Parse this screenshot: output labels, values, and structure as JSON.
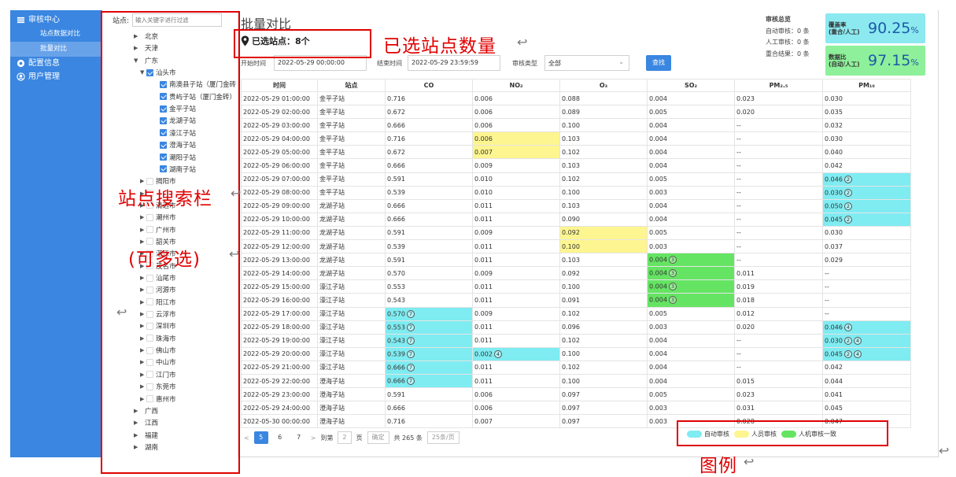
{
  "nav": {
    "items": [
      {
        "label": "审核中心",
        "icon": "audit-icon"
      },
      {
        "label": "站点数据对比",
        "sub": true
      },
      {
        "label": "批量对比",
        "sub": true,
        "active": true
      },
      {
        "label": "配置信息",
        "icon": "config-icon"
      },
      {
        "label": "用户管理",
        "icon": "user-icon"
      }
    ]
  },
  "tree": {
    "label": "站点:",
    "placeholder": "输入关键字进行过滤",
    "nodes": [
      {
        "label": "北京",
        "level": 1,
        "arrow": "▶",
        "cb": "none"
      },
      {
        "label": "天津",
        "level": 1,
        "arrow": "▶",
        "cb": "none"
      },
      {
        "label": "广东",
        "level": 1,
        "arrow": "▼",
        "cb": "none"
      },
      {
        "label": "汕头市",
        "level": 2,
        "arrow": "▼",
        "cb": "on"
      },
      {
        "label": "南澳县子站（厦门金砖",
        "level": 3,
        "arrow": "",
        "cb": "on"
      },
      {
        "label": "贵屿子站（厦门金砖）",
        "level": 3,
        "arrow": "",
        "cb": "on"
      },
      {
        "label": "金平子站",
        "level": 3,
        "arrow": "",
        "cb": "on"
      },
      {
        "label": "龙湖子站",
        "level": 3,
        "arrow": "",
        "cb": "on"
      },
      {
        "label": "濠江子站",
        "level": 3,
        "arrow": "",
        "cb": "on"
      },
      {
        "label": "澄海子站",
        "level": 3,
        "arrow": "",
        "cb": "on"
      },
      {
        "label": "潮阳子站",
        "level": 3,
        "arrow": "",
        "cb": "on"
      },
      {
        "label": "湖南子站",
        "level": 3,
        "arrow": "",
        "cb": "on"
      },
      {
        "label": "揭阳市",
        "level": 2,
        "arrow": "▶",
        "cb": "off"
      },
      {
        "label": "",
        "level": 2,
        "arrow": "▶",
        "cb": "off"
      },
      {
        "label": "清远市",
        "level": 2,
        "arrow": "▶",
        "cb": "off"
      },
      {
        "label": "潮州市",
        "level": 2,
        "arrow": "▶",
        "cb": "off"
      },
      {
        "label": "广州市",
        "level": 2,
        "arrow": "▶",
        "cb": "off"
      },
      {
        "label": "韶关市",
        "level": 2,
        "arrow": "▶",
        "cb": "off"
      },
      {
        "label": "湛江市",
        "level": 2,
        "arrow": "▶",
        "cb": "off"
      },
      {
        "label": "茂名市",
        "level": 2,
        "arrow": "▶",
        "cb": "off"
      },
      {
        "label": "汕尾市",
        "level": 2,
        "arrow": "▶",
        "cb": "off"
      },
      {
        "label": "河源市",
        "level": 2,
        "arrow": "▶",
        "cb": "off"
      },
      {
        "label": "阳江市",
        "level": 2,
        "arrow": "▶",
        "cb": "off"
      },
      {
        "label": "云浮市",
        "level": 2,
        "arrow": "▶",
        "cb": "off"
      },
      {
        "label": "深圳市",
        "level": 2,
        "arrow": "▶",
        "cb": "off"
      },
      {
        "label": "珠海市",
        "level": 2,
        "arrow": "▶",
        "cb": "off"
      },
      {
        "label": "佛山市",
        "level": 2,
        "arrow": "▶",
        "cb": "off"
      },
      {
        "label": "中山市",
        "level": 2,
        "arrow": "▶",
        "cb": "off"
      },
      {
        "label": "江门市",
        "level": 2,
        "arrow": "▶",
        "cb": "off"
      },
      {
        "label": "东莞市",
        "level": 2,
        "arrow": "▶",
        "cb": "off"
      },
      {
        "label": "惠州市",
        "level": 2,
        "arrow": "▶",
        "cb": "off"
      },
      {
        "label": "广西",
        "level": 1,
        "arrow": "▶",
        "cb": "none"
      },
      {
        "label": "江西",
        "level": 1,
        "arrow": "▶",
        "cb": "none"
      },
      {
        "label": "福建",
        "level": 1,
        "arrow": "▶",
        "cb": "none"
      },
      {
        "label": "湖南",
        "level": 1,
        "arrow": "▶",
        "cb": "none"
      }
    ]
  },
  "page": {
    "title": "批量对比",
    "selected_label": "已选站点：8个"
  },
  "filters": {
    "start_label": "开始时间",
    "start_value": "2022-05-29 00:00:00",
    "end_label": "结束时间",
    "end_value": "2022-05-29 23:59:59",
    "type_label": "审核类型",
    "type_value": "全部",
    "search_button": "查找"
  },
  "stats": {
    "title": "审核总览",
    "auto": "自动审核：0 条",
    "manual": "人工审核：0 条",
    "overlap": "重合结果：0 条"
  },
  "cards": [
    {
      "label1": "覆盖率",
      "label2": "(重合/人工)",
      "value": "90.25",
      "unit": "%",
      "bg": "#8be9ef"
    },
    {
      "label1": "数据比",
      "label2": "(自动/人工)",
      "value": "97.15",
      "unit": "%",
      "bg": "#8ef09a"
    }
  ],
  "table": {
    "headers": [
      "时间",
      "站点",
      "CO",
      "NO₂",
      "O₃",
      "SO₂",
      "PM₂.₅",
      "PM₁₀"
    ],
    "rows": [
      [
        "2022-05-29 01:00:00",
        "金平子站",
        "0.716",
        "0.006",
        "0.088",
        "0.004",
        "0.023",
        "0.030"
      ],
      [
        "2022-05-29 02:00:00",
        "金平子站",
        "0.672",
        "0.006",
        "0.089",
        "0.005",
        "0.020",
        "0.035"
      ],
      [
        "2022-05-29 03:00:00",
        "金平子站",
        "0.666",
        "0.006",
        "0.100",
        "0.004",
        "--",
        "0.032"
      ],
      [
        "2022-05-29 04:00:00",
        "金平子站",
        "0.716",
        "0.006",
        "0.103",
        "0.004",
        "--",
        "0.030"
      ],
      [
        "2022-05-29 05:00:00",
        "金平子站",
        "0.672",
        "0.007",
        "0.102",
        "0.004",
        "--",
        "0.040"
      ],
      [
        "2022-05-29 06:00:00",
        "金平子站",
        "0.666",
        "0.009",
        "0.103",
        "0.004",
        "--",
        "0.042"
      ],
      [
        "2022-05-29 07:00:00",
        "金平子站",
        "0.591",
        "0.010",
        "0.102",
        "0.005",
        "--",
        "0.046"
      ],
      [
        "2022-05-29 08:00:00",
        "金平子站",
        "0.539",
        "0.010",
        "0.100",
        "0.003",
        "--",
        "0.030"
      ],
      [
        "2022-05-29 09:00:00",
        "龙湖子站",
        "0.666",
        "0.011",
        "0.103",
        "0.004",
        "--",
        "0.050"
      ],
      [
        "2022-05-29 10:00:00",
        "龙湖子站",
        "0.666",
        "0.011",
        "0.090",
        "0.004",
        "--",
        "0.045"
      ],
      [
        "2022-05-29 11:00:00",
        "龙湖子站",
        "0.591",
        "0.009",
        "0.092",
        "0.005",
        "--",
        "0.030"
      ],
      [
        "2022-05-29 12:00:00",
        "龙湖子站",
        "0.539",
        "0.011",
        "0.100",
        "0.003",
        "--",
        "0.037"
      ],
      [
        "2022-05-29 13:00:00",
        "龙湖子站",
        "0.591",
        "0.011",
        "0.103",
        "0.004",
        "--",
        "0.029"
      ],
      [
        "2022-05-29 14:00:00",
        "龙湖子站",
        "0.570",
        "0.009",
        "0.092",
        "0.004",
        "0.011",
        "--"
      ],
      [
        "2022-05-29 15:00:00",
        "濠江子站",
        "0.553",
        "0.011",
        "0.100",
        "0.004",
        "0.019",
        "--"
      ],
      [
        "2022-05-29 16:00:00",
        "濠江子站",
        "0.543",
        "0.011",
        "0.091",
        "0.004",
        "0.018",
        "--"
      ],
      [
        "2022-05-29 17:00:00",
        "濠江子站",
        "0.570",
        "0.009",
        "0.102",
        "0.005",
        "0.012",
        "--"
      ],
      [
        "2022-05-29 18:00:00",
        "濠江子站",
        "0.553",
        "0.011",
        "0.096",
        "0.003",
        "0.020",
        "0.046"
      ],
      [
        "2022-05-29 19:00:00",
        "濠江子站",
        "0.543",
        "0.011",
        "0.102",
        "0.004",
        "--",
        "0.030"
      ],
      [
        "2022-05-29 20:00:00",
        "濠江子站",
        "0.539",
        "0.002",
        "0.100",
        "0.004",
        "--",
        "0.045"
      ],
      [
        "2022-05-29 21:00:00",
        "濠江子站",
        "0.666",
        "0.011",
        "0.102",
        "0.004",
        "--",
        "0.042"
      ],
      [
        "2022-05-29 22:00:00",
        "澄海子站",
        "0.666",
        "0.011",
        "0.100",
        "0.004",
        "0.015",
        "0.044"
      ],
      [
        "2022-05-29 23:00:00",
        "澄海子站",
        "0.591",
        "0.006",
        "0.097",
        "0.005",
        "0.023",
        "0.041"
      ],
      [
        "2022-05-29 24:00:00",
        "澄海子站",
        "0.666",
        "0.006",
        "0.097",
        "0.003",
        "0.031",
        "0.045"
      ],
      [
        "2022-05-30 00:00:00",
        "澄海子站",
        "0.716",
        "0.007",
        "0.097",
        "0.003",
        "0.028",
        "0.047"
      ]
    ],
    "highlights": [
      {
        "r": 3,
        "c": 3,
        "color": "yellow",
        "badges": []
      },
      {
        "r": 4,
        "c": 3,
        "color": "yellow",
        "badges": []
      },
      {
        "r": 6,
        "c": 7,
        "color": "cyan",
        "badges": [
          "2"
        ]
      },
      {
        "r": 7,
        "c": 7,
        "color": "cyan",
        "badges": [
          "2"
        ]
      },
      {
        "r": 8,
        "c": 7,
        "color": "cyan",
        "badges": [
          "2"
        ]
      },
      {
        "r": 9,
        "c": 7,
        "color": "cyan",
        "badges": [
          "2"
        ]
      },
      {
        "r": 10,
        "c": 4,
        "color": "yellow",
        "badges": []
      },
      {
        "r": 11,
        "c": 4,
        "color": "yellow",
        "badges": []
      },
      {
        "r": 12,
        "c": 5,
        "color": "green",
        "badges": [
          "3"
        ]
      },
      {
        "r": 13,
        "c": 5,
        "color": "green",
        "badges": [
          "3"
        ]
      },
      {
        "r": 14,
        "c": 5,
        "color": "green",
        "badges": [
          "3"
        ]
      },
      {
        "r": 15,
        "c": 5,
        "color": "green",
        "badges": [
          "3"
        ]
      },
      {
        "r": 16,
        "c": 2,
        "color": "cyan",
        "badges": [
          "7"
        ]
      },
      {
        "r": 17,
        "c": 2,
        "color": "cyan",
        "badges": [
          "7"
        ]
      },
      {
        "r": 18,
        "c": 2,
        "color": "cyan",
        "badges": [
          "7"
        ]
      },
      {
        "r": 19,
        "c": 2,
        "color": "cyan",
        "badges": [
          "7"
        ]
      },
      {
        "r": 20,
        "c": 2,
        "color": "cyan",
        "badges": [
          "7"
        ]
      },
      {
        "r": 21,
        "c": 2,
        "color": "cyan",
        "badges": [
          "7"
        ]
      },
      {
        "r": 17,
        "c": 7,
        "color": "cyan",
        "badges": [
          "4"
        ]
      },
      {
        "r": 18,
        "c": 7,
        "color": "cyan",
        "badges": [
          "2",
          "4"
        ]
      },
      {
        "r": 19,
        "c": 7,
        "color": "cyan",
        "badges": [
          "2",
          "4"
        ]
      },
      {
        "r": 19,
        "c": 3,
        "color": "cyan",
        "badges": [
          "4"
        ]
      }
    ]
  },
  "pager": {
    "prev": "<",
    "pages": [
      "5",
      "6",
      "7"
    ],
    "next": ">",
    "goto": "到第",
    "page_input": "2",
    "page_unit": "页",
    "confirm": "确定",
    "total": "共 265 条",
    "size": "25条/页"
  },
  "legend": {
    "items": [
      {
        "label": "自动审核",
        "color": "#7fecf2"
      },
      {
        "label": "人员审核",
        "color": "#fdf590"
      },
      {
        "label": "人机审核一致",
        "color": "#65e463"
      }
    ]
  },
  "annotations": {
    "selected_count": "已选站点数量",
    "search_bar": "站点搜索栏",
    "multi": "(可多选)",
    "legend": "图例"
  }
}
